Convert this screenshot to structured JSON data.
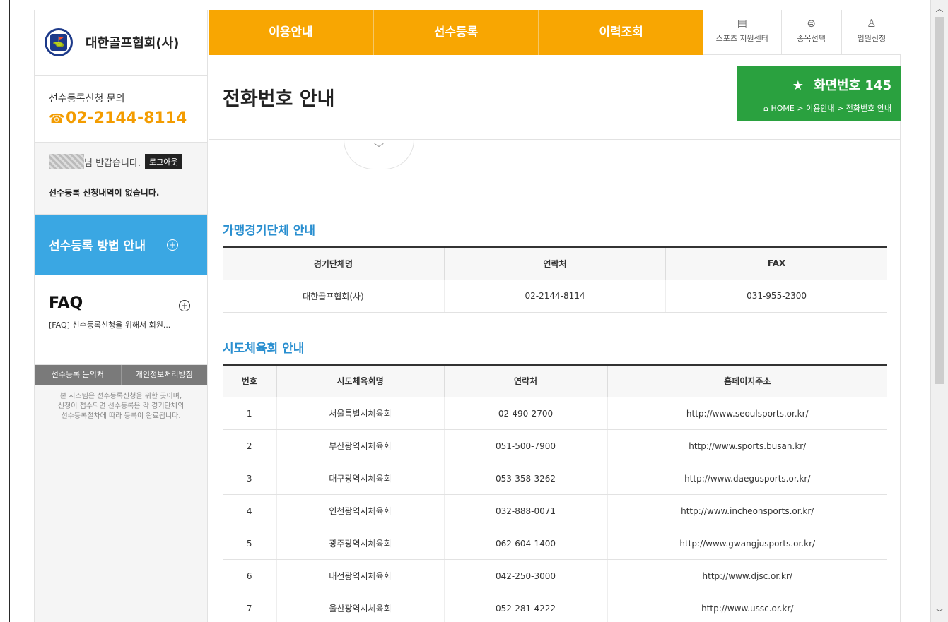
{
  "sidebar": {
    "logo_text": "대한골프협회(사)",
    "contact_label": "선수등록신청 문의",
    "contact_phone": "02-2144-8114",
    "greeting": "님 반갑습니다.",
    "logout_label": "로그아웃",
    "status": "선수등록 신청내역이 없습니다.",
    "method_label": "선수등록 방법 안내",
    "faq_title": "FAQ",
    "faq_item": "[FAQ]  선수등록신청을 위해서 회원...",
    "foot_tabs": [
      "선수등록 문의처",
      "개인정보처리방침"
    ],
    "foot_note": [
      "본 시스템은 선수등록신청을 위한 곳이며,",
      "신청이 접수되면 선수등록은 각 경기단체의",
      "선수등록절차에 따라 등록이 완료됩니다."
    ]
  },
  "topnav": [
    "이용안내",
    "선수등록",
    "이력조회"
  ],
  "utilnav": [
    {
      "label": "스포츠 지원센터",
      "icon": "id-card-icon"
    },
    {
      "label": "종목선택",
      "icon": "ball-icon"
    },
    {
      "label": "임원신청",
      "icon": "person-icon"
    }
  ],
  "header": {
    "page_title": "전화번호 안내",
    "screen_label": "화면번호 145",
    "breadcrumb": "HOME > 이용안내 > 전화번호 안내"
  },
  "section1": {
    "title": "가맹경기단체 안내",
    "headers": [
      "경기단체명",
      "연락처",
      "FAX"
    ],
    "rows": [
      [
        "대한골프협회(사)",
        "02-2144-8114",
        "031-955-2300"
      ]
    ]
  },
  "section2": {
    "title": "시도체육회 안내",
    "headers": [
      "번호",
      "시도체육회명",
      "연락처",
      "홈페이지주소"
    ],
    "rows": [
      [
        "1",
        "서울특별시체육회",
        "02-490-2700",
        "http://www.seoulsports.or.kr/"
      ],
      [
        "2",
        "부산광역시체육회",
        "051-500-7900",
        "http://www.sports.busan.kr/"
      ],
      [
        "3",
        "대구광역시체육회",
        "053-358-3262",
        "http://www.daegusports.or.kr/"
      ],
      [
        "4",
        "인천광역시체육회",
        "032-888-0071",
        "http://www.incheonsports.or.kr/"
      ],
      [
        "5",
        "광주광역시체육회",
        "062-604-1400",
        "http://www.gwangjusports.or.kr/"
      ],
      [
        "6",
        "대전광역시체육회",
        "042-250-3000",
        "http://www.djsc.or.kr/"
      ],
      [
        "7",
        "울산광역시체육회",
        "052-281-4222",
        "http://www.ussc.or.kr/"
      ]
    ]
  },
  "colors": {
    "nav_orange": "#f8a602",
    "accent_blue": "#3aa7e3",
    "screen_green": "#2aa13f",
    "phone_orange": "#f39c00"
  }
}
